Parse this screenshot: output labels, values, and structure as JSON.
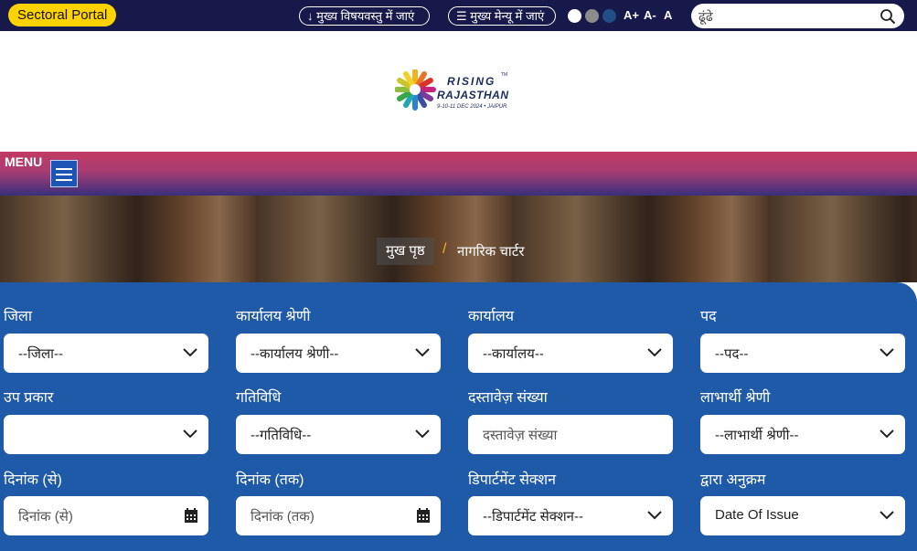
{
  "topbar": {
    "sectoral_label": "Sectoral Portal",
    "skip_content": "↓ मुख्य विषयवस्तु में जाएं",
    "skip_menu": "☰ मुख्य मेन्यू में जाएं",
    "font_increase": "A+",
    "font_decrease": "A-",
    "font_reset": "A",
    "search_placeholder": "ढूंढे"
  },
  "logo": {
    "word1": "RISING",
    "word2": "RAJASTHAN",
    "subtitle": "9-10-11 DEC 2024 • JAIPUR",
    "tm": "TM"
  },
  "menu": {
    "label": "MENU"
  },
  "breadcrumb": {
    "home": "मुख पृष्ठ",
    "separator": "/",
    "current": "नागरिक चार्टर"
  },
  "form": {
    "district": {
      "label": "जिला",
      "value": "--जिला--"
    },
    "office_category": {
      "label": "कार्यालय श्रेणी",
      "value": "--कार्यालय श्रेणी--"
    },
    "office": {
      "label": "कार्यालय",
      "value": "--कार्यालय--"
    },
    "post": {
      "label": "पद",
      "value": "--पद--"
    },
    "sub_type": {
      "label": "उप प्रकार",
      "value": ""
    },
    "activity": {
      "label": "गतिविधि",
      "value": "--गतिविधि--"
    },
    "document_number": {
      "label": "दस्तावेज़ संख्या",
      "placeholder": "दस्तावेज़ संख्या"
    },
    "beneficiary_category": {
      "label": "लाभार्थी श्रेणी",
      "value": "--लाभार्थी श्रेणी--"
    },
    "date_from": {
      "label": "दिनांक (से)",
      "placeholder": "दिनांक (से)"
    },
    "date_to": {
      "label": "दिनांक (तक)",
      "placeholder": "दिनांक (तक)"
    },
    "department_section": {
      "label": "डिपार्टमेंट सेक्शन",
      "value": "--डिपार्टमेंट सेक्शन--"
    },
    "sort_by": {
      "label": "द्वारा अनुक्रम",
      "value": "Date Of Issue"
    }
  },
  "colors": {
    "topbar_bg": "#16194a",
    "sectoral_bg": "#ffd200",
    "form_bg": "#1f5aa8",
    "accent_sep": "#ffb02e"
  },
  "icons": {
    "search": "search-icon",
    "chevron": "chevron-down-icon",
    "calendar": "calendar-icon",
    "hamburger": "hamburger-icon"
  }
}
